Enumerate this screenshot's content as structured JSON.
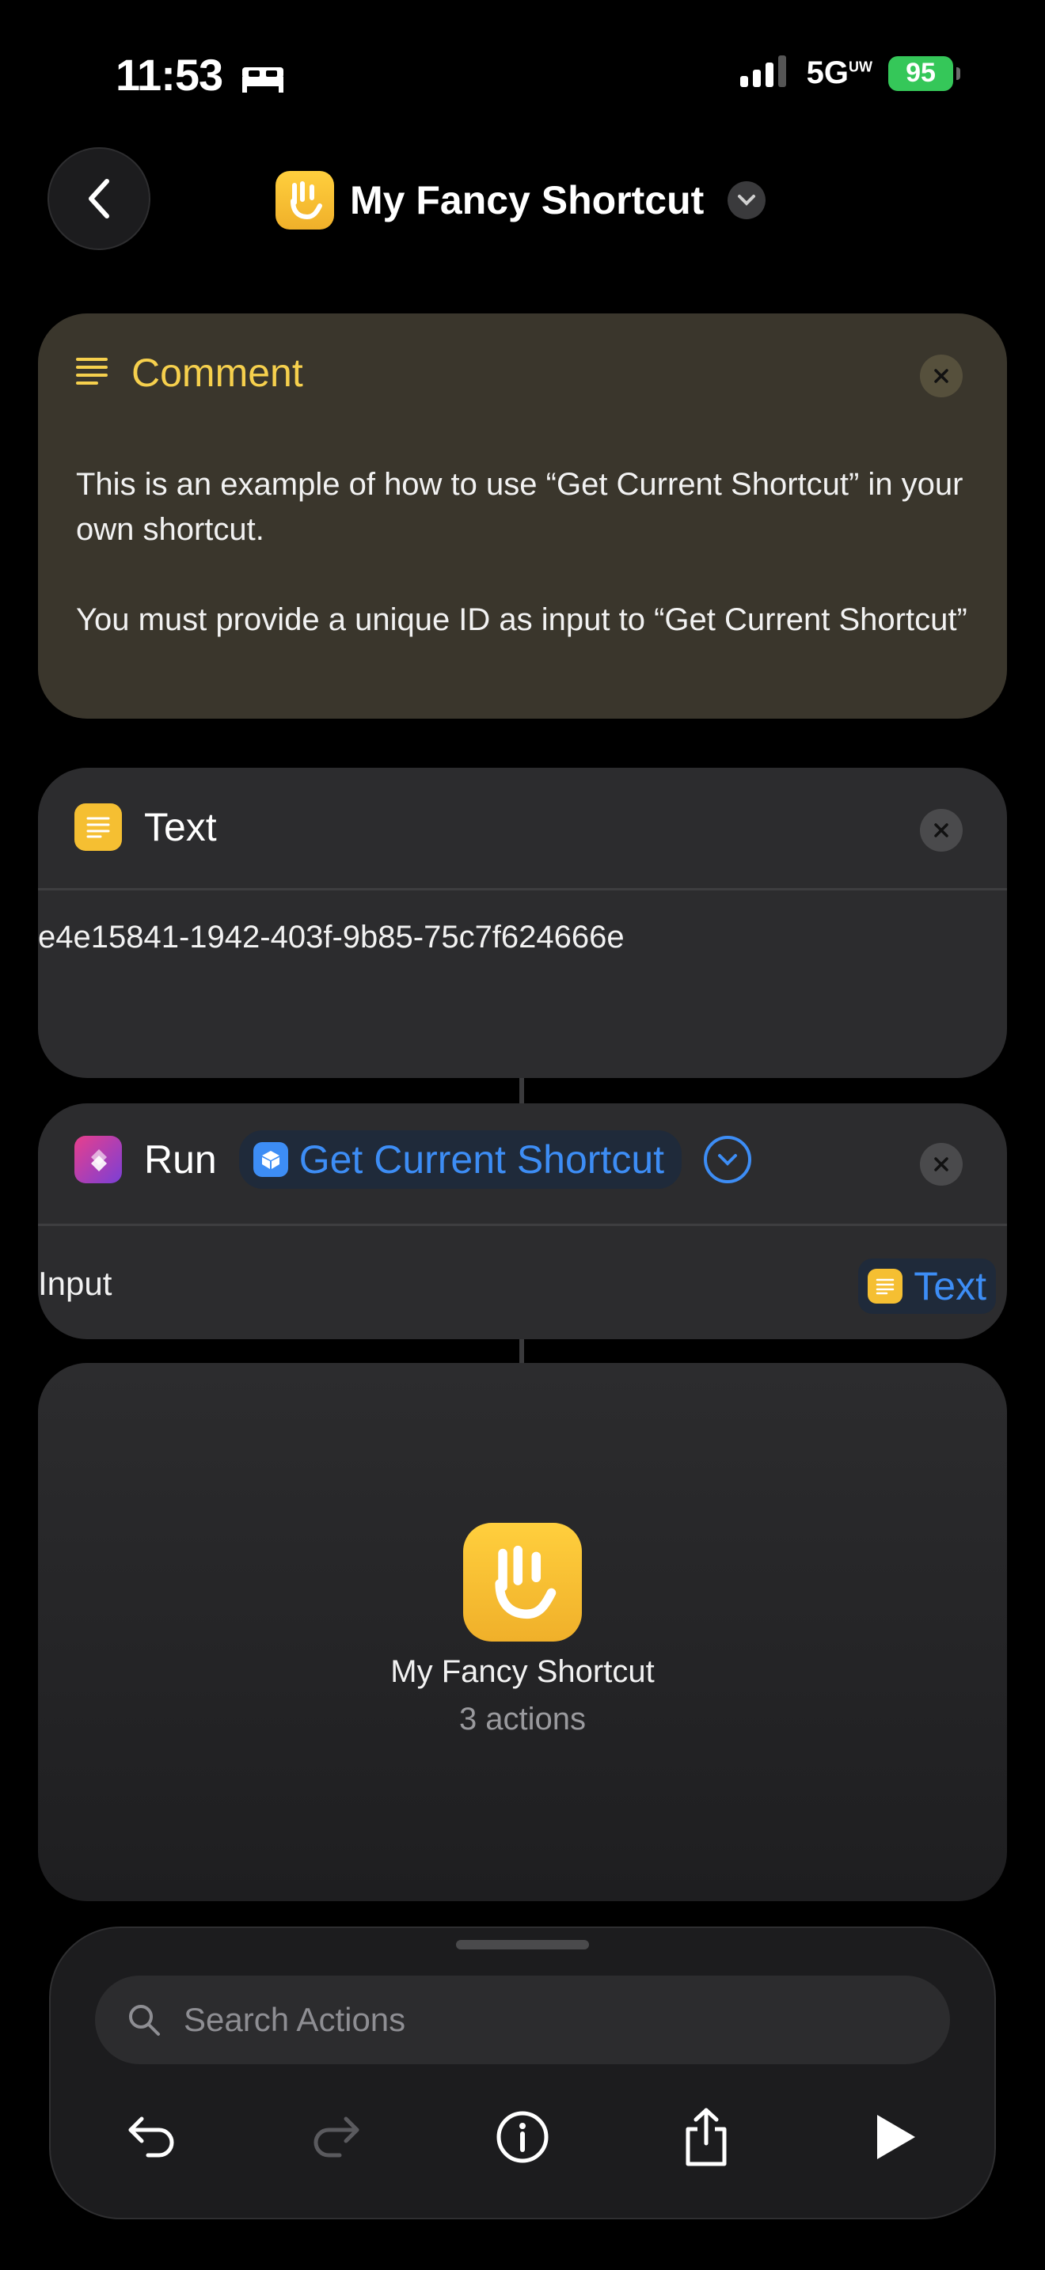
{
  "status_bar": {
    "time": "11:53",
    "network": "5G",
    "network_sup": "UW",
    "battery": "95"
  },
  "header": {
    "title": "My Fancy Shortcut"
  },
  "comment_action": {
    "title": "Comment",
    "paragraphs": [
      "This is an example of how to use “Get Current Shortcut” in your own shortcut.",
      "You must provide a unique ID as input to “Get Current Shortcut”"
    ]
  },
  "text_action": {
    "title": "Text",
    "value": "e4e15841-1942-403f-9b85-75c7f624666e"
  },
  "run_action": {
    "verb": "Run",
    "shortcut_name": "Get Current Shortcut",
    "input_label": "Input",
    "input_value": "Text"
  },
  "shortcut_preview": {
    "name": "My Fancy Shortcut",
    "actions": "3 actions"
  },
  "bottom_panel": {
    "search_placeholder": "Search Actions"
  },
  "colors": {
    "accent": "#3d8df5",
    "comment_title": "#f6d04d",
    "app_yellow": "#f5bf32",
    "background": "#000000"
  }
}
